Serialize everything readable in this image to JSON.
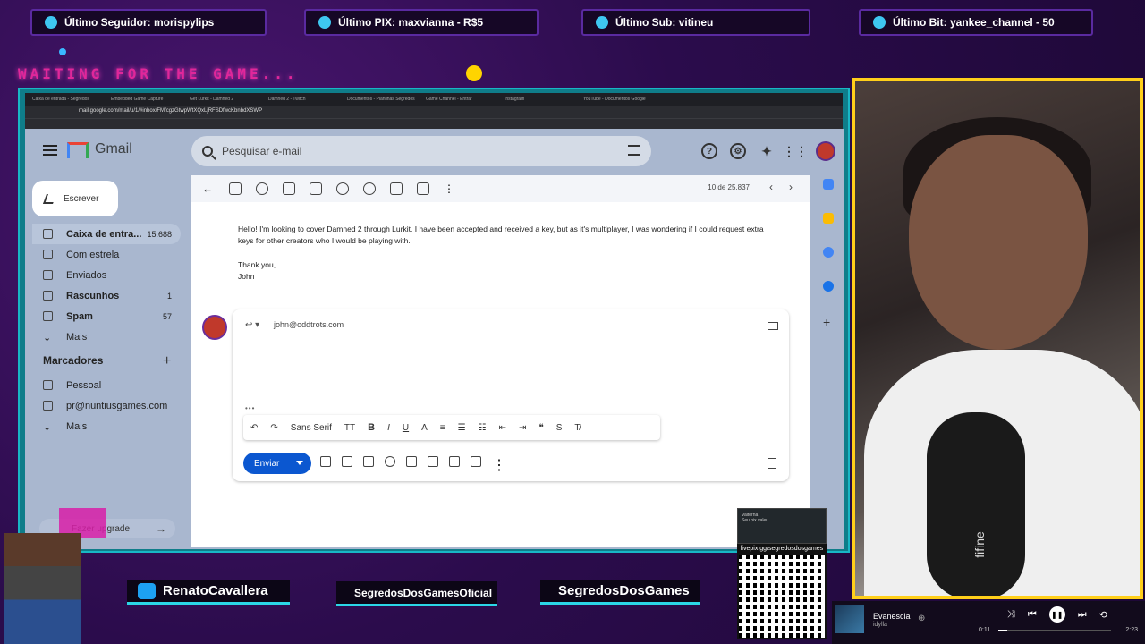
{
  "overlay": {
    "top_pills": [
      {
        "label": "Último Seguidor: morispylips",
        "icon": "heart-user-icon"
      },
      {
        "label": "Último PIX: maxvianna - R$5",
        "icon": "dollar-icon"
      },
      {
        "label": "Último Sub: vitineu",
        "icon": "star-icon"
      },
      {
        "label": "Último Bit: yankee_channel - 50",
        "icon": "gem-icon"
      }
    ],
    "waiting_text": "WAITING FOR THE GAME...",
    "socials": [
      {
        "label": "RenatoCavallera",
        "icon": "twitter-icon",
        "color": "#1da1f2"
      },
      {
        "label": "SegredosDosGamesOficial",
        "icon": "instagram-icon",
        "color": "#d62976"
      },
      {
        "label": "SegredosDosGames",
        "icon": "kick-icon",
        "color": "#53fc18"
      }
    ],
    "qr": {
      "header_line1": "Valterna",
      "header_line2": "Seu pix valeu",
      "url": "livepix.gg/segredosdosgames"
    },
    "player": {
      "song": "Evanescia",
      "artist": "idylla",
      "time_current": "0:11",
      "time_total": "2:23",
      "progress": 0.08
    },
    "colors": {
      "accent_cyan": "#2bd6e6",
      "cam_border": "#ffcf1a",
      "waiting": "#e0279a"
    }
  },
  "browser": {
    "tabs": [
      "Caixa de entrada - Segredos",
      "Embedded Game Capture",
      "Get Lurkit - Damned 2",
      "Damned 2 - Twitch",
      "Documentos - Planilhas Segredos",
      "Game Channel - Entrar",
      "Instagram",
      "YouTube - Documentos Google"
    ],
    "url": "mail.google.com/mail/u/1/#inbox/FMfcgzGtwpWtXQxLjRFSDfwcKbnbdXSWP"
  },
  "gmail": {
    "brand": "Gmail",
    "search_placeholder": "Pesquisar e-mail",
    "compose": "Escrever",
    "nav": [
      {
        "label": "Caixa de entra...",
        "count": "15.688",
        "icon": "inbox-icon"
      },
      {
        "label": "Com estrela",
        "count": "",
        "icon": "star-icon"
      },
      {
        "label": "Enviados",
        "count": "",
        "icon": "send-icon"
      },
      {
        "label": "Rascunhos",
        "count": "1",
        "icon": "draft-icon"
      },
      {
        "label": "Spam",
        "count": "57",
        "icon": "spam-icon"
      },
      {
        "label": "Mais",
        "count": "",
        "icon": "chevron-down-icon"
      }
    ],
    "labels_title": "Marcadores",
    "labels": [
      {
        "label": "Pessoal",
        "icon": "label-icon"
      },
      {
        "label": "pr@nuntiusgames.com",
        "icon": "label-icon"
      },
      {
        "label": "Mais",
        "icon": "chevron-down-icon"
      }
    ],
    "upgrade": "Fazer upgrade",
    "message_count": "10 de 25.837",
    "body": "Hello! I'm looking to cover Damned 2 through Lurkit. I have been accepted and received a key, but as it's multiplayer, I was wondering if I could request extra keys for other creators who I would be playing with.",
    "signoff1": "Thank you,",
    "signoff2": "John",
    "reply_to": "john@oddtrots.com",
    "font_name": "Sans Serif",
    "send_label": "Enviar"
  }
}
